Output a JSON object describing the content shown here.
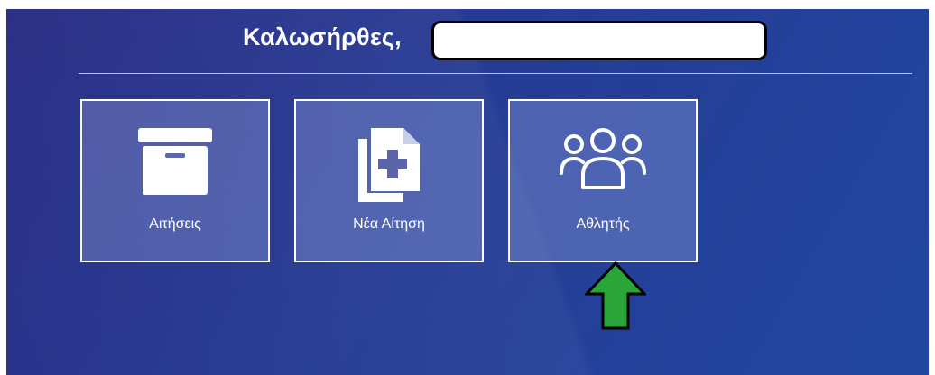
{
  "header": {
    "greeting": "Καλωσήρθες,"
  },
  "tiles": [
    {
      "label": "Αιτήσεις",
      "icon": "archive-box-icon"
    },
    {
      "label": "Νέα Αίτηση",
      "icon": "new-document-icon"
    },
    {
      "label": "Αθλητής",
      "icon": "users-group-icon"
    }
  ],
  "annotation": {
    "arrow_color": "#2aa53a",
    "arrow_outline": "#000000",
    "points_to": "Αθλητής"
  },
  "colors": {
    "background": "#263b94",
    "tile_border": "#ffffff",
    "text": "#ffffff"
  }
}
